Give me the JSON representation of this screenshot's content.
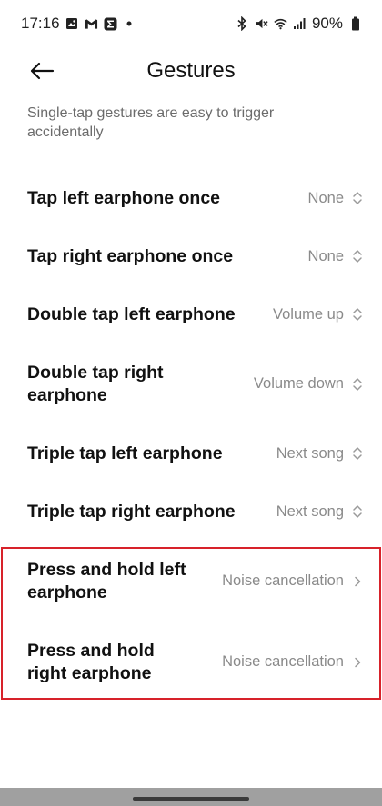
{
  "status_bar": {
    "time": "17:16",
    "battery": "90%"
  },
  "header": {
    "title": "Gestures"
  },
  "subtitle": "Single-tap gestures are easy to trigger accidentally",
  "settings": [
    {
      "label": "Tap left earphone once",
      "value": "None",
      "control": "updown"
    },
    {
      "label": "Tap right earphone once",
      "value": "None",
      "control": "updown"
    },
    {
      "label": "Double tap left earphone",
      "value": "Volume up",
      "control": "updown"
    },
    {
      "label": "Double tap right earphone",
      "value": "Volume down",
      "control": "updown"
    },
    {
      "label": "Triple tap left earphone",
      "value": "Next song",
      "control": "updown"
    },
    {
      "label": "Triple tap right earphone",
      "value": "Next song",
      "control": "updown"
    },
    {
      "label": "Press and hold left earphone",
      "value": "Noise cancellation",
      "control": "chevron-right"
    },
    {
      "label": "Press and hold right earphone",
      "value": "Noise cancellation",
      "control": "chevron-right"
    }
  ],
  "colors": {
    "highlight_border": "#d7222a",
    "value_text": "#8a8a8a",
    "subtitle_text": "#6b6b6b"
  }
}
